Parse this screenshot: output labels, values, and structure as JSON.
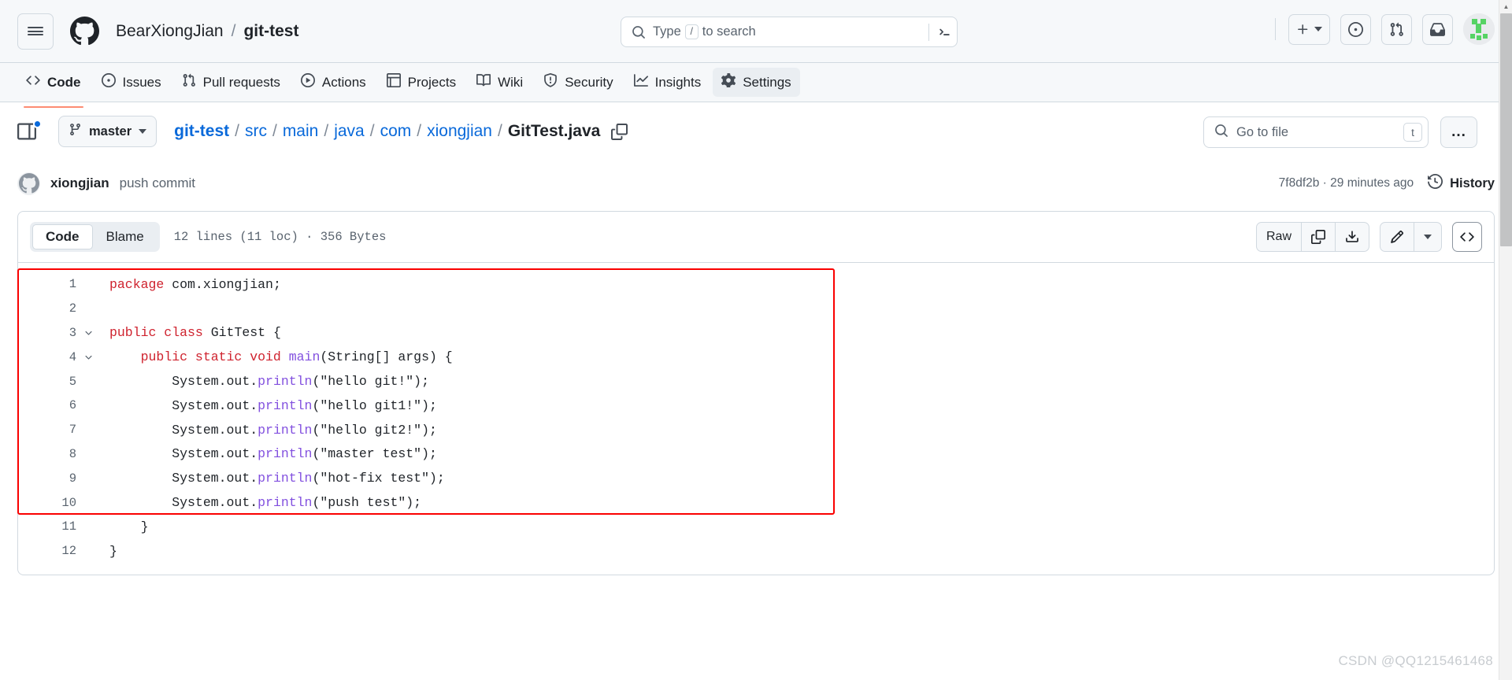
{
  "header": {
    "menu_label": "menu",
    "owner": "BearXiongJian",
    "separator": "/",
    "repo": "git-test",
    "search": {
      "placeholder_before": "Type",
      "key": "/",
      "placeholder_after": "to search"
    },
    "actions": [
      {
        "name": "create-new-button",
        "glyph": "+"
      },
      {
        "name": "issues-button",
        "glyph": "issue"
      },
      {
        "name": "pull-requests-button",
        "glyph": "pr"
      },
      {
        "name": "inbox-button",
        "glyph": "inbox"
      }
    ]
  },
  "repo_nav": {
    "tabs": [
      {
        "label": "Code",
        "icon": "code-icon",
        "active": true,
        "selected": false
      },
      {
        "label": "Issues",
        "icon": "issue-opened-icon",
        "active": false,
        "selected": false
      },
      {
        "label": "Pull requests",
        "icon": "git-pull-request-icon",
        "active": false,
        "selected": false
      },
      {
        "label": "Actions",
        "icon": "play-icon",
        "active": false,
        "selected": false
      },
      {
        "label": "Projects",
        "icon": "table-icon",
        "active": false,
        "selected": false
      },
      {
        "label": "Wiki",
        "icon": "book-icon",
        "active": false,
        "selected": false
      },
      {
        "label": "Security",
        "icon": "shield-icon",
        "active": false,
        "selected": false
      },
      {
        "label": "Insights",
        "icon": "graph-icon",
        "active": false,
        "selected": false
      },
      {
        "label": "Settings",
        "icon": "gear-icon",
        "active": false,
        "selected": true
      }
    ]
  },
  "file_header": {
    "branch": "master",
    "breadcrumb": [
      {
        "label": "git-test",
        "type": "root-link"
      },
      {
        "label": "src",
        "type": "link"
      },
      {
        "label": "main",
        "type": "link"
      },
      {
        "label": "java",
        "type": "link"
      },
      {
        "label": "com",
        "type": "link"
      },
      {
        "label": "xiongjian",
        "type": "link"
      },
      {
        "label": "GitTest.java",
        "type": "current"
      }
    ],
    "separator": "/",
    "go_to_file_placeholder": "Go to file",
    "go_to_file_key": "t",
    "more_label": "..."
  },
  "commit": {
    "author": "xiongjian",
    "message": "push commit",
    "sha_and_time": "7f8df2b · 29 minutes ago",
    "history_label": "History"
  },
  "code_header": {
    "tabs": [
      {
        "label": "Code",
        "active": true
      },
      {
        "label": "Blame",
        "active": false
      }
    ],
    "file_meta": "12 lines (11 loc) · 356 Bytes",
    "tools": [
      {
        "name": "raw-button",
        "label": "Raw"
      },
      {
        "name": "copy-raw-button",
        "label": ""
      },
      {
        "name": "download-raw-button",
        "label": ""
      },
      {
        "name": "edit-file-button",
        "label": ""
      },
      {
        "name": "edit-dropdown-button",
        "label": ""
      },
      {
        "name": "code-symbols-button",
        "label": ""
      }
    ]
  },
  "code": {
    "lines": [
      {
        "n": "1",
        "fold": false,
        "tokens": [
          {
            "t": "package ",
            "c": "kw"
          },
          {
            "t": "com.xiongjian;",
            "c": ""
          }
        ]
      },
      {
        "n": "2",
        "fold": false,
        "tokens": [
          {
            "t": "",
            "c": ""
          }
        ]
      },
      {
        "n": "3",
        "fold": true,
        "tokens": [
          {
            "t": "public class ",
            "c": "kw"
          },
          {
            "t": "GitTest {",
            "c": ""
          }
        ]
      },
      {
        "n": "4",
        "fold": true,
        "tokens": [
          {
            "t": "    ",
            "c": ""
          },
          {
            "t": "public static void ",
            "c": "kw"
          },
          {
            "t": "main",
            "c": "fn"
          },
          {
            "t": "(String[] args) {",
            "c": ""
          }
        ]
      },
      {
        "n": "5",
        "fold": false,
        "tokens": [
          {
            "t": "        System.out.",
            "c": ""
          },
          {
            "t": "println",
            "c": "fn"
          },
          {
            "t": "(\"hello git!\");",
            "c": ""
          }
        ]
      },
      {
        "n": "6",
        "fold": false,
        "tokens": [
          {
            "t": "        System.out.",
            "c": ""
          },
          {
            "t": "println",
            "c": "fn"
          },
          {
            "t": "(\"hello git1!\");",
            "c": ""
          }
        ]
      },
      {
        "n": "7",
        "fold": false,
        "tokens": [
          {
            "t": "        System.out.",
            "c": ""
          },
          {
            "t": "println",
            "c": "fn"
          },
          {
            "t": "(\"hello git2!\");",
            "c": ""
          }
        ]
      },
      {
        "n": "8",
        "fold": false,
        "tokens": [
          {
            "t": "        System.out.",
            "c": ""
          },
          {
            "t": "println",
            "c": "fn"
          },
          {
            "t": "(\"master test\");",
            "c": ""
          }
        ]
      },
      {
        "n": "9",
        "fold": false,
        "tokens": [
          {
            "t": "        System.out.",
            "c": ""
          },
          {
            "t": "println",
            "c": "fn"
          },
          {
            "t": "(\"hot-fix test\");",
            "c": ""
          }
        ]
      },
      {
        "n": "10",
        "fold": false,
        "tokens": [
          {
            "t": "        System.out.",
            "c": ""
          },
          {
            "t": "println",
            "c": "fn"
          },
          {
            "t": "(\"push test\");",
            "c": ""
          }
        ]
      },
      {
        "n": "11",
        "fold": false,
        "tokens": [
          {
            "t": "    }",
            "c": ""
          }
        ]
      },
      {
        "n": "12",
        "fold": false,
        "tokens": [
          {
            "t": "}",
            "c": ""
          }
        ]
      }
    ]
  },
  "watermark": "CSDN @QQ1215461468",
  "colors": {
    "accent_blue": "#0969da",
    "keyword_red": "#cf222e",
    "function_purple": "#8250df",
    "active_tab_underline": "#fd8c73",
    "annotation_red": "#fa0000",
    "header_bg": "#f6f8fa",
    "border": "#d1d9e0"
  }
}
